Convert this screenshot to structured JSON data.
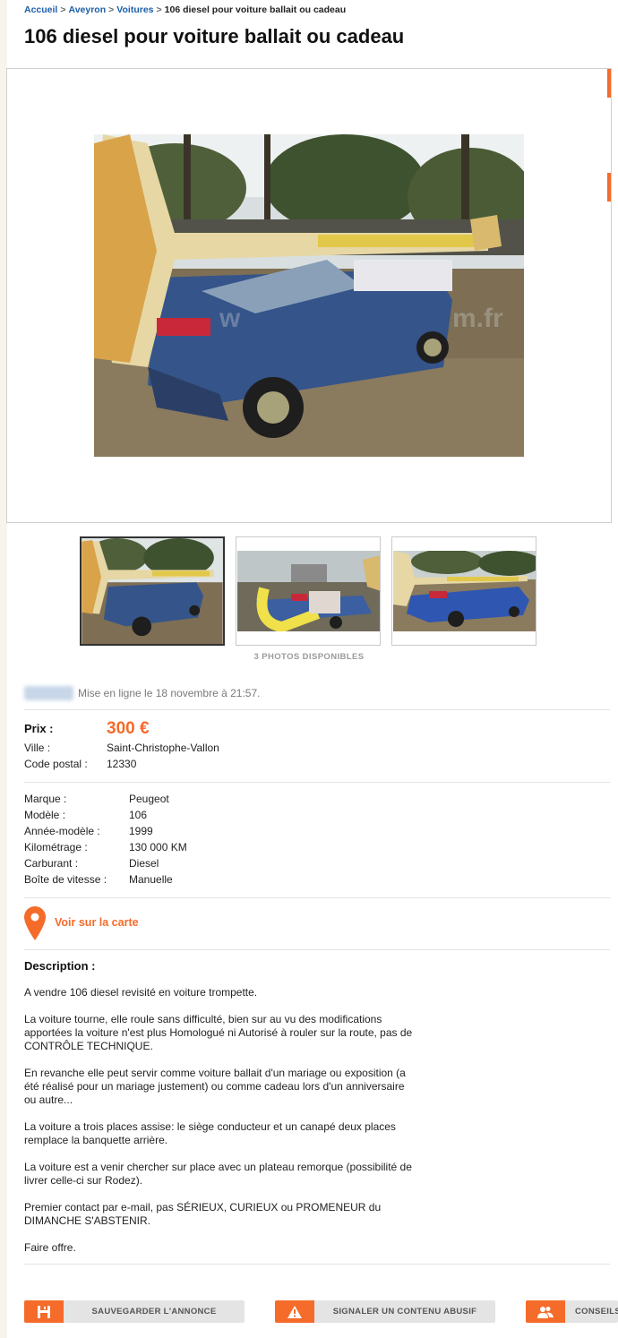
{
  "breadcrumb": {
    "home": "Accueil",
    "region": "Aveyron",
    "category": "Voitures",
    "current": "106 diesel pour voiture ballait ou cadeau",
    "separator": ">"
  },
  "ad": {
    "title": "106 diesel pour voiture ballait ou cadeau",
    "photos_available": "3 PHOTOS DISPONIBLES",
    "posted": "Mise en ligne le 18 novembre à 21:57.",
    "price_label": "Prix :",
    "price": "300 €",
    "location": [
      {
        "label": "Ville :",
        "value": "Saint-Christophe-Vallon"
      },
      {
        "label": "Code postal :",
        "value": "12330"
      }
    ],
    "criteria": [
      {
        "label": "Marque :",
        "value": "Peugeot"
      },
      {
        "label": "Modèle :",
        "value": "106"
      },
      {
        "label": "Année-modèle :",
        "value": "1999"
      },
      {
        "label": "Kilométrage :",
        "value": "130 000 KM"
      },
      {
        "label": "Carburant :",
        "value": "Diesel"
      },
      {
        "label": "Boîte de vitesse :",
        "value": "Manuelle"
      }
    ],
    "map_link": "Voir sur la carte",
    "description_title": "Description :",
    "description": [
      "A vendre 106 diesel revisité en voiture trompette.",
      "La voiture tourne, elle roule sans difficulté, bien sur au vu des modifications apportées la voiture n'est plus Homologué ni Autorisé à rouler sur la route, pas de CONTRÔLE TECHNIQUE.",
      "En revanche elle peut servir comme voiture ballait d'un mariage ou exposition (a été réalisé pour un mariage justement) ou comme cadeau lors d'un anniversaire ou autre...",
      "La voiture a trois places assise: le siège conducteur et un canapé deux places remplace la banquette arrière.",
      "La voiture est a venir chercher sur place avec un plateau remorque (possibilité de livrer celle-ci sur Rodez).",
      "Premier contact par e-mail, pas SÉRIEUX, CURIEUX ou PROMENEUR du DIMANCHE S'ABSTENIR.",
      "Faire offre."
    ]
  },
  "actions": {
    "save": "SAUVEGARDER L'ANNONCE",
    "report": "SIGNALER UN CONTENU ABUSIF",
    "advice": "CONSEILS"
  },
  "icons": {
    "map": "map-pin-icon",
    "save": "floppy-disk-icon",
    "report": "warning-triangle-icon",
    "advice": "users-icon"
  },
  "colors": {
    "accent": "#f56b2a",
    "link": "#1c5ea8",
    "muted": "#7a7a7a"
  }
}
